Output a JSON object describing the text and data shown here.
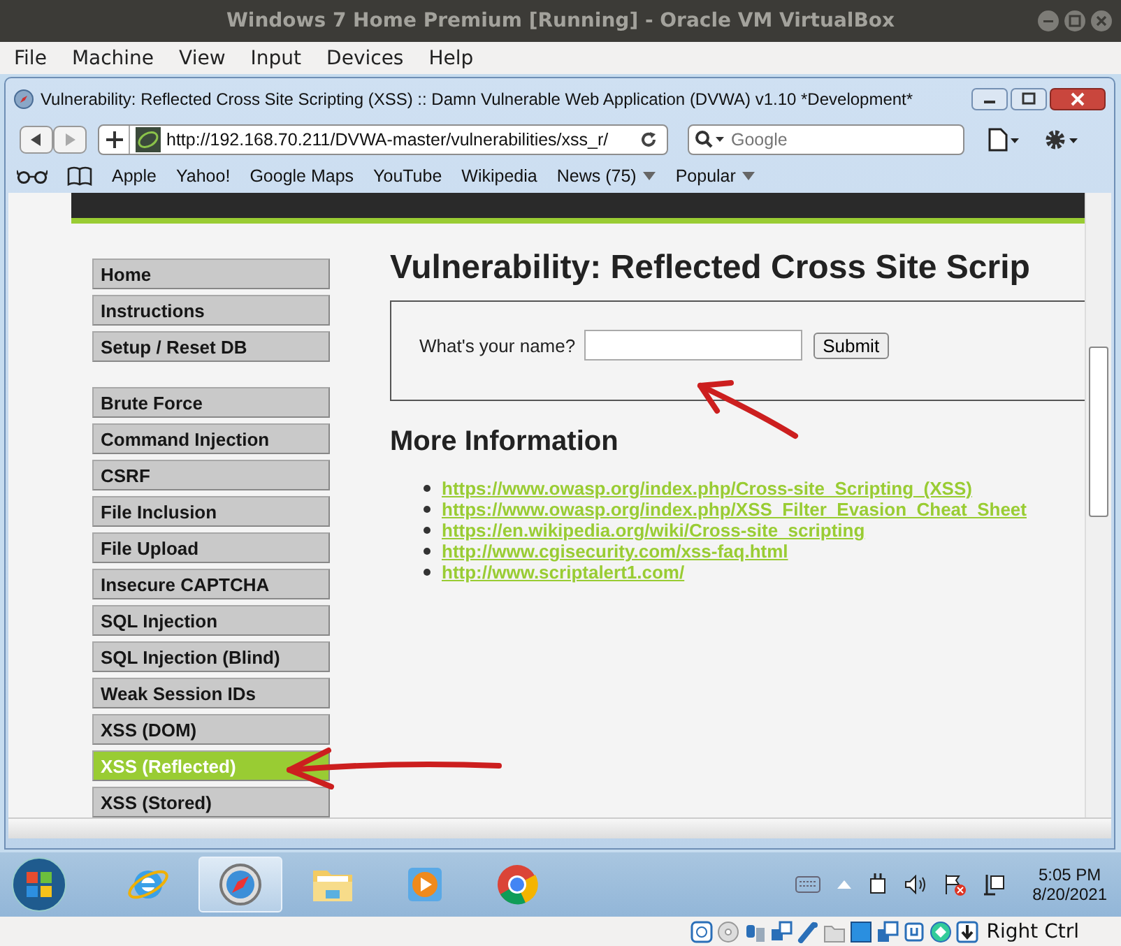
{
  "vm_window": {
    "title": "Windows 7 Home Premium [Running] - Oracle VM VirtualBox",
    "menu": [
      "File",
      "Machine",
      "View",
      "Input",
      "Devices",
      "Help"
    ]
  },
  "browser": {
    "title": "Vulnerability: Reflected Cross Site Scripting (XSS) :: Damn Vulnerable Web Application (DVWA) v1.10 *Development*",
    "url": "http://192.168.70.211/DVWA-master/vulnerabilities/xss_r/",
    "search": {
      "placeholder": "Google"
    },
    "bookmarks": [
      {
        "label": "Apple",
        "kind": "link"
      },
      {
        "label": "Yahoo!",
        "kind": "link"
      },
      {
        "label": "Google Maps",
        "kind": "link"
      },
      {
        "label": "YouTube",
        "kind": "link"
      },
      {
        "label": "Wikipedia",
        "kind": "link"
      },
      {
        "label": "News (75)",
        "kind": "menu"
      },
      {
        "label": "Popular",
        "kind": "menu"
      }
    ]
  },
  "page": {
    "sidebar": [
      [
        {
          "label": "Home",
          "selected": false
        },
        {
          "label": "Instructions",
          "selected": false
        },
        {
          "label": "Setup / Reset DB",
          "selected": false
        }
      ],
      [
        {
          "label": "Brute Force",
          "selected": false
        },
        {
          "label": "Command Injection",
          "selected": false
        },
        {
          "label": "CSRF",
          "selected": false
        },
        {
          "label": "File Inclusion",
          "selected": false
        },
        {
          "label": "File Upload",
          "selected": false
        },
        {
          "label": "Insecure CAPTCHA",
          "selected": false
        },
        {
          "label": "SQL Injection",
          "selected": false
        },
        {
          "label": "SQL Injection (Blind)",
          "selected": false
        },
        {
          "label": "Weak Session IDs",
          "selected": false
        },
        {
          "label": "XSS (DOM)",
          "selected": false
        },
        {
          "label": "XSS (Reflected)",
          "selected": true
        },
        {
          "label": "XSS (Stored)",
          "selected": false
        }
      ]
    ],
    "heading": "Vulnerability: Reflected Cross Site Scrip",
    "form": {
      "label": "What's your name?",
      "button": "Submit"
    },
    "more_heading": "More Information",
    "links": [
      "https://www.owasp.org/index.php/Cross-site_Scripting_(XSS)",
      "https://www.owasp.org/index.php/XSS_Filter_Evasion_Cheat_Sheet",
      "https://en.wikipedia.org/wiki/Cross-site_scripting",
      "http://www.cgisecurity.com/xss-faq.html",
      "http://www.scriptalert1.com/"
    ]
  },
  "taskbar": {
    "apps": [
      {
        "kind": "ie",
        "selected": false
      },
      {
        "kind": "safari",
        "selected": true
      },
      {
        "kind": "folder",
        "selected": false
      },
      {
        "kind": "media",
        "selected": false
      },
      {
        "kind": "chrome",
        "selected": false
      }
    ],
    "time": "5:05 PM",
    "date": "8/20/2021"
  },
  "status_bar": {
    "host_key": "Right Ctrl"
  }
}
